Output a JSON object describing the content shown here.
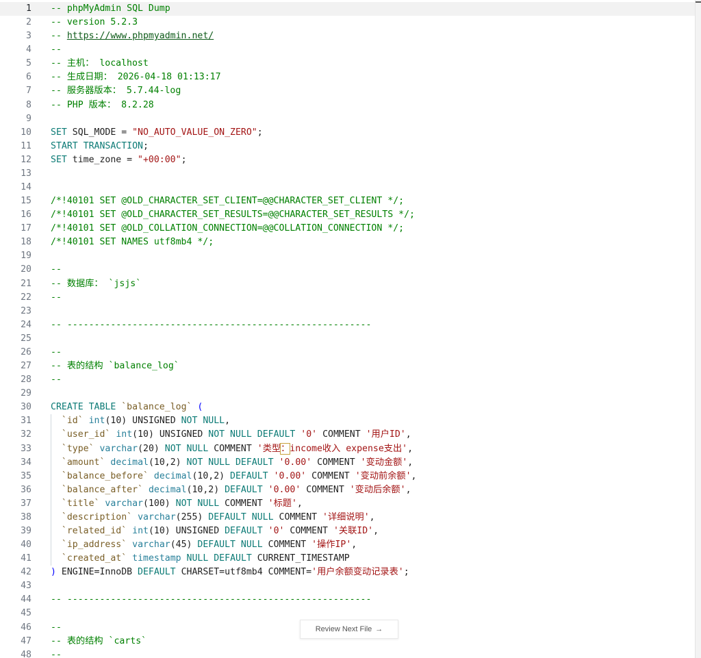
{
  "review_button": {
    "label": "Review Next File",
    "icon": "arrow-right-icon"
  },
  "lines": [
    {
      "n": "1",
      "tokens": [
        [
          "cm",
          "-- phpMyAdmin SQL Dump"
        ]
      ]
    },
    {
      "n": "2",
      "tokens": [
        [
          "cm",
          "-- version 5.2.3"
        ]
      ]
    },
    {
      "n": "3",
      "tokens": [
        [
          "cm",
          "-- "
        ],
        [
          "link",
          "https://www.phpmyadmin.net/"
        ]
      ]
    },
    {
      "n": "4",
      "tokens": [
        [
          "cm",
          "--"
        ]
      ]
    },
    {
      "n": "5",
      "tokens": [
        [
          "cm",
          "-- 主机： localhost"
        ]
      ]
    },
    {
      "n": "6",
      "tokens": [
        [
          "cm",
          "-- 生成日期： 2026-04-18 01:13:17"
        ]
      ]
    },
    {
      "n": "7",
      "tokens": [
        [
          "cm",
          "-- 服务器版本： 5.7.44-log"
        ]
      ]
    },
    {
      "n": "8",
      "tokens": [
        [
          "cm",
          "-- PHP 版本： 8.2.28"
        ]
      ]
    },
    {
      "n": "9",
      "tokens": []
    },
    {
      "n": "10",
      "tokens": [
        [
          "kw2",
          "SET"
        ],
        [
          "df",
          " SQL_MODE = "
        ],
        [
          "st",
          "\"NO_AUTO_VALUE_ON_ZERO\""
        ],
        [
          "df",
          ";"
        ]
      ]
    },
    {
      "n": "11",
      "tokens": [
        [
          "kw2",
          "START TRANSACTION"
        ],
        [
          "df",
          ";"
        ]
      ]
    },
    {
      "n": "12",
      "tokens": [
        [
          "kw2",
          "SET"
        ],
        [
          "df",
          " time_zone = "
        ],
        [
          "st",
          "\"+00:00\""
        ],
        [
          "df",
          ";"
        ]
      ]
    },
    {
      "n": "13",
      "tokens": []
    },
    {
      "n": "14",
      "tokens": []
    },
    {
      "n": "15",
      "tokens": [
        [
          "cm",
          "/*!40101 SET @OLD_CHARACTER_SET_CLIENT=@@CHARACTER_SET_CLIENT */;"
        ]
      ]
    },
    {
      "n": "16",
      "tokens": [
        [
          "cm",
          "/*!40101 SET @OLD_CHARACTER_SET_RESULTS=@@CHARACTER_SET_RESULTS */;"
        ]
      ]
    },
    {
      "n": "17",
      "tokens": [
        [
          "cm",
          "/*!40101 SET @OLD_COLLATION_CONNECTION=@@COLLATION_CONNECTION */;"
        ]
      ]
    },
    {
      "n": "18",
      "tokens": [
        [
          "cm",
          "/*!40101 SET NAMES utf8mb4 */;"
        ]
      ]
    },
    {
      "n": "19",
      "tokens": []
    },
    {
      "n": "20",
      "tokens": [
        [
          "cm",
          "--"
        ]
      ]
    },
    {
      "n": "21",
      "tokens": [
        [
          "cm",
          "-- 数据库： `jsjs`"
        ]
      ]
    },
    {
      "n": "22",
      "tokens": [
        [
          "cm",
          "--"
        ]
      ]
    },
    {
      "n": "23",
      "tokens": []
    },
    {
      "n": "24",
      "tokens": [
        [
          "cm",
          "-- --------------------------------------------------------"
        ]
      ]
    },
    {
      "n": "25",
      "tokens": []
    },
    {
      "n": "26",
      "tokens": [
        [
          "cm",
          "--"
        ]
      ]
    },
    {
      "n": "27",
      "tokens": [
        [
          "cm",
          "-- 表的结构 `balance_log`"
        ]
      ]
    },
    {
      "n": "28",
      "tokens": [
        [
          "cm",
          "--"
        ]
      ]
    },
    {
      "n": "29",
      "tokens": []
    },
    {
      "n": "30",
      "tokens": [
        [
          "kw2",
          "CREATE TABLE"
        ],
        [
          "df",
          " "
        ],
        [
          "id",
          "`balance_log`"
        ],
        [
          "df",
          " "
        ],
        [
          "kw",
          "("
        ]
      ]
    },
    {
      "n": "31",
      "guide": true,
      "tokens": [
        [
          "df",
          "  "
        ],
        [
          "id",
          "`id`"
        ],
        [
          "df",
          " "
        ],
        [
          "ty",
          "int"
        ],
        [
          "df",
          "(10) UNSIGNED "
        ],
        [
          "kw2",
          "NOT NULL"
        ],
        [
          "df",
          ","
        ]
      ]
    },
    {
      "n": "32",
      "guide": true,
      "tokens": [
        [
          "df",
          "  "
        ],
        [
          "id",
          "`user_id`"
        ],
        [
          "df",
          " "
        ],
        [
          "ty",
          "int"
        ],
        [
          "df",
          "(10) UNSIGNED "
        ],
        [
          "kw2",
          "NOT NULL DEFAULT"
        ],
        [
          "df",
          " "
        ],
        [
          "st",
          "'0'"
        ],
        [
          "df",
          " COMMENT "
        ],
        [
          "st",
          "'用户ID'"
        ],
        [
          "df",
          ","
        ]
      ]
    },
    {
      "n": "33",
      "guide": true,
      "tokens": [
        [
          "df",
          "  "
        ],
        [
          "id",
          "`type`"
        ],
        [
          "df",
          " "
        ],
        [
          "ty",
          "varchar"
        ],
        [
          "df",
          "(20) "
        ],
        [
          "kw2",
          "NOT NULL"
        ],
        [
          "df",
          " COMMENT "
        ],
        [
          "st",
          "'类型"
        ],
        [
          "stbox",
          "："
        ],
        [
          "st",
          "income收入 expense支出'"
        ],
        [
          "df",
          ","
        ]
      ]
    },
    {
      "n": "34",
      "guide": true,
      "tokens": [
        [
          "df",
          "  "
        ],
        [
          "id",
          "`amount`"
        ],
        [
          "df",
          " "
        ],
        [
          "ty",
          "decimal"
        ],
        [
          "df",
          "(10,2) "
        ],
        [
          "kw2",
          "NOT NULL DEFAULT"
        ],
        [
          "df",
          " "
        ],
        [
          "st",
          "'0.00'"
        ],
        [
          "df",
          " COMMENT "
        ],
        [
          "st",
          "'变动金额'"
        ],
        [
          "df",
          ","
        ]
      ]
    },
    {
      "n": "35",
      "guide": true,
      "tokens": [
        [
          "df",
          "  "
        ],
        [
          "id",
          "`balance_before`"
        ],
        [
          "df",
          " "
        ],
        [
          "ty",
          "decimal"
        ],
        [
          "df",
          "(10,2) "
        ],
        [
          "kw2",
          "DEFAULT"
        ],
        [
          "df",
          " "
        ],
        [
          "st",
          "'0.00'"
        ],
        [
          "df",
          " COMMENT "
        ],
        [
          "st",
          "'变动前余额'"
        ],
        [
          "df",
          ","
        ]
      ]
    },
    {
      "n": "36",
      "guide": true,
      "tokens": [
        [
          "df",
          "  "
        ],
        [
          "id",
          "`balance_after`"
        ],
        [
          "df",
          " "
        ],
        [
          "ty",
          "decimal"
        ],
        [
          "df",
          "(10,2) "
        ],
        [
          "kw2",
          "DEFAULT"
        ],
        [
          "df",
          " "
        ],
        [
          "st",
          "'0.00'"
        ],
        [
          "df",
          " COMMENT "
        ],
        [
          "st",
          "'变动后余额'"
        ],
        [
          "df",
          ","
        ]
      ]
    },
    {
      "n": "37",
      "guide": true,
      "tokens": [
        [
          "df",
          "  "
        ],
        [
          "id",
          "`title`"
        ],
        [
          "df",
          " "
        ],
        [
          "ty",
          "varchar"
        ],
        [
          "df",
          "(100) "
        ],
        [
          "kw2",
          "NOT NULL"
        ],
        [
          "df",
          " COMMENT "
        ],
        [
          "st",
          "'标题'"
        ],
        [
          "df",
          ","
        ]
      ]
    },
    {
      "n": "38",
      "guide": true,
      "tokens": [
        [
          "df",
          "  "
        ],
        [
          "id",
          "`description`"
        ],
        [
          "df",
          " "
        ],
        [
          "ty",
          "varchar"
        ],
        [
          "df",
          "(255) "
        ],
        [
          "kw2",
          "DEFAULT NULL"
        ],
        [
          "df",
          " COMMENT "
        ],
        [
          "st",
          "'详细说明'"
        ],
        [
          "df",
          ","
        ]
      ]
    },
    {
      "n": "39",
      "guide": true,
      "tokens": [
        [
          "df",
          "  "
        ],
        [
          "id",
          "`related_id`"
        ],
        [
          "df",
          " "
        ],
        [
          "ty",
          "int"
        ],
        [
          "df",
          "(10) UNSIGNED "
        ],
        [
          "kw2",
          "DEFAULT"
        ],
        [
          "df",
          " "
        ],
        [
          "st",
          "'0'"
        ],
        [
          "df",
          " COMMENT "
        ],
        [
          "st",
          "'关联ID'"
        ],
        [
          "df",
          ","
        ]
      ]
    },
    {
      "n": "40",
      "guide": true,
      "tokens": [
        [
          "df",
          "  "
        ],
        [
          "id",
          "`ip_address`"
        ],
        [
          "df",
          " "
        ],
        [
          "ty",
          "varchar"
        ],
        [
          "df",
          "(45) "
        ],
        [
          "kw2",
          "DEFAULT NULL"
        ],
        [
          "df",
          " COMMENT "
        ],
        [
          "st",
          "'操作IP'"
        ],
        [
          "df",
          ","
        ]
      ]
    },
    {
      "n": "41",
      "guide": true,
      "tokens": [
        [
          "df",
          "  "
        ],
        [
          "id",
          "`created_at`"
        ],
        [
          "df",
          " "
        ],
        [
          "ty",
          "timestamp"
        ],
        [
          "df",
          " "
        ],
        [
          "kw2",
          "NULL DEFAULT"
        ],
        [
          "df",
          " CURRENT_TIMESTAMP"
        ]
      ]
    },
    {
      "n": "42",
      "tokens": [
        [
          "kw",
          ")"
        ],
        [
          "df",
          " ENGINE=InnoDB "
        ],
        [
          "kw2",
          "DEFAULT"
        ],
        [
          "df",
          " CHARSET=utf8mb4 COMMENT="
        ],
        [
          "st",
          "'用户余额变动记录表'"
        ],
        [
          "df",
          ";"
        ]
      ]
    },
    {
      "n": "43",
      "tokens": []
    },
    {
      "n": "44",
      "tokens": [
        [
          "cm",
          "-- --------------------------------------------------------"
        ]
      ]
    },
    {
      "n": "45",
      "tokens": []
    },
    {
      "n": "46",
      "tokens": [
        [
          "cm",
          "--"
        ]
      ]
    },
    {
      "n": "47",
      "tokens": [
        [
          "cm",
          "-- 表的结构 `carts`"
        ]
      ]
    },
    {
      "n": "48",
      "tokens": [
        [
          "cm",
          "--"
        ]
      ]
    }
  ],
  "colors": {
    "comment": "#008000",
    "keyword": "#0b7a75",
    "string": "#a31515",
    "identifier": "#795e26"
  }
}
